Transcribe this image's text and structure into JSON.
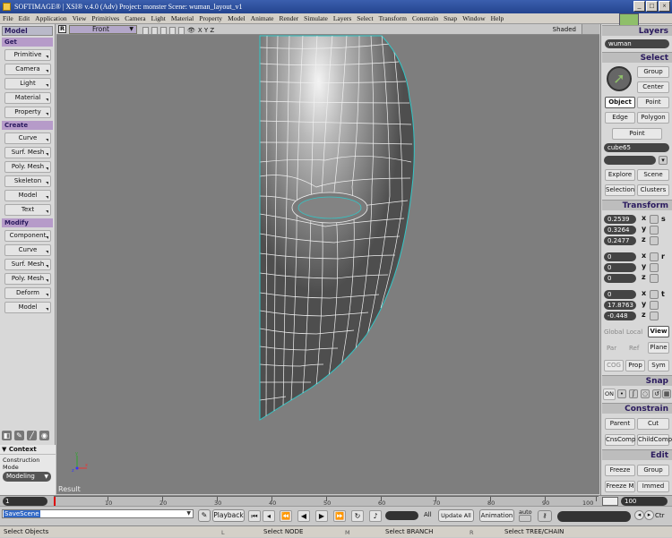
{
  "window": {
    "title": "SOFTIMAGE® | XSI® v.4.0 (Adv) Project: monster    Scene: wuman_layout_v1",
    "min": "_",
    "max": "□",
    "close": "×"
  },
  "menu": [
    "File",
    "Edit",
    "Application",
    "View",
    "Primitives",
    "Camera",
    "Light",
    "Material",
    "Property",
    "Model",
    "Animate",
    "Render",
    "Simulate",
    "Layers",
    "Select",
    "Transform",
    "Constrain",
    "Snap",
    "Window",
    "Help"
  ],
  "left_panel": {
    "mode": "Model",
    "get": {
      "header": "Get",
      "buttons": [
        "Primitive",
        "Camera",
        "Light",
        "Material",
        "Property"
      ]
    },
    "create": {
      "header": "Create",
      "buttons": [
        "Curve",
        "Surf. Mesh",
        "Poly. Mesh",
        "Skeleton",
        "Model",
        "Text"
      ]
    },
    "modify": {
      "header": "Modify",
      "buttons": [
        "Component",
        "Curve",
        "Surf. Mesh",
        "Poly. Mesh",
        "Deform",
        "Model"
      ]
    },
    "context": {
      "header": "Context",
      "mode_label": "Construction Mode",
      "mode_value": "Modeling"
    }
  },
  "viewport": {
    "letter": "R",
    "view": "Front",
    "axes": "X Y Z",
    "display_mode": "Shaded",
    "status": "Result"
  },
  "right_panel": {
    "layers": {
      "header": "Layers",
      "current": "wuman"
    },
    "select": {
      "header": "Select",
      "group": "Group",
      "center": "Center",
      "object": "Object",
      "point": "Point",
      "edge": "Edge",
      "polygon": "Polygon",
      "point2": "Point",
      "selected_name": "cube65",
      "explore": "Explore",
      "scene": "Scene",
      "selection": "Selection",
      "clusters": "Clusters"
    },
    "transform": {
      "header": "Transform",
      "scale": [
        "0.2539",
        "0.3264",
        "0.2477"
      ],
      "rotation": [
        "0",
        "0",
        "0"
      ],
      "translation": [
        "0",
        "17.8763",
        "-0.448"
      ],
      "axes": [
        "x",
        "y",
        "z"
      ],
      "scale_key": "s",
      "rotation_key": "r",
      "translation_key": "t",
      "global": "Global",
      "local": "Local",
      "view": "View",
      "par": "Par",
      "ref": "Ref",
      "plane": "Plane",
      "cog": "COG",
      "prop": "Prop",
      "sym": "Sym"
    },
    "snap": {
      "header": "Snap",
      "on": "ON"
    },
    "constrain": {
      "header": "Constrain",
      "parent": "Parent",
      "cut": "Cut",
      "cnscomp": "CnsComp",
      "childcomp": "ChildComp"
    },
    "edit": {
      "header": "Edit",
      "freeze": "Freeze",
      "group": "Group",
      "freeze_m": "Freeze M",
      "immed": "Immed"
    }
  },
  "timeline": {
    "start": "1",
    "end": "100",
    "labels": [
      "10",
      "20",
      "30",
      "40",
      "50",
      "60",
      "70",
      "80",
      "90",
      "100"
    ]
  },
  "command_bar": {
    "command": "SaveScene",
    "playback": "Playback",
    "all": "All",
    "update_all": "Update All",
    "animation": "Animation",
    "auto": "auto",
    "ctr": "Ctr"
  },
  "status": {
    "left": "Select Objects",
    "l_key": "L",
    "mid": "Select NODE",
    "m_key": "M",
    "right_mid": "Select BRANCH",
    "r_key": "R",
    "right": "Select TREE/CHAIN"
  },
  "colors": {
    "title_bar": "#24448f",
    "section_header": "#b69bc9",
    "viewport_bg": "#7e7e7e",
    "wire": "#f0f0f0",
    "outline": "#33c6c6"
  }
}
